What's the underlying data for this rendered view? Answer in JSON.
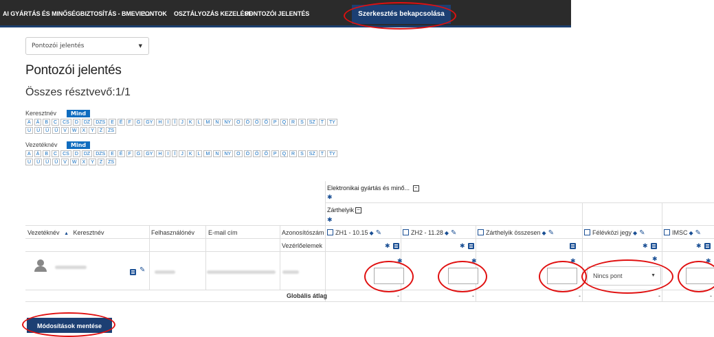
{
  "nav": {
    "items": [
      "AI GYÁRTÁS ÉS MINŐSÉGBIZTOSÍTÁS - BMEVIE...",
      "PONTOK",
      "OSZTÁLYOZÁS KEZELÉSE",
      "PONTOZÓI JELENTÉS"
    ],
    "edit_toggle": "Szerkesztés bekapcsolása"
  },
  "report_select": {
    "value": "Pontozói jelentés"
  },
  "page_title": "Pontozói jelentés",
  "participants": "Összes résztvevő:1/1",
  "filters": {
    "firstname_label": "Keresztnév",
    "lastname_label": "Vezetéknév",
    "all_label": "Mind",
    "letters_row1": [
      "A",
      "Á",
      "B",
      "C",
      "CS",
      "D",
      "DZ",
      "DZS",
      "E",
      "É",
      "F",
      "G",
      "GY",
      "H",
      "I",
      "Í",
      "J",
      "K",
      "L",
      "M",
      "N",
      "NY",
      "O",
      "Ó",
      "Ö",
      "Ő",
      "P",
      "Q",
      "R",
      "S",
      "SZ",
      "T",
      "TY"
    ],
    "letters_row2": [
      "U",
      "Ú",
      "Ü",
      "Ű",
      "V",
      "W",
      "X",
      "Y",
      "Z",
      "ZS"
    ]
  },
  "table": {
    "category_course": "Elektronikai gyártás és minő...",
    "category_exams": "Zárthelyik",
    "col_lastname": "Vezetéknév",
    "col_firstname": "Keresztnév",
    "col_username": "Felhasználónév",
    "col_email": "E-mail cím",
    "col_id": "Azonosítószám",
    "controls_label": "Vezérlőelemek",
    "grade_columns": [
      "ZH1 - 10.15",
      "ZH2 - 11.28",
      "Zárthelyik összesen",
      "Félévközi jegy",
      "IMSC"
    ],
    "select_value": "Nincs pont",
    "average_label": "Globális átlag",
    "average_values": [
      "-",
      "-",
      "-",
      "-",
      "-"
    ]
  },
  "save_button": "Módosítások mentése"
}
